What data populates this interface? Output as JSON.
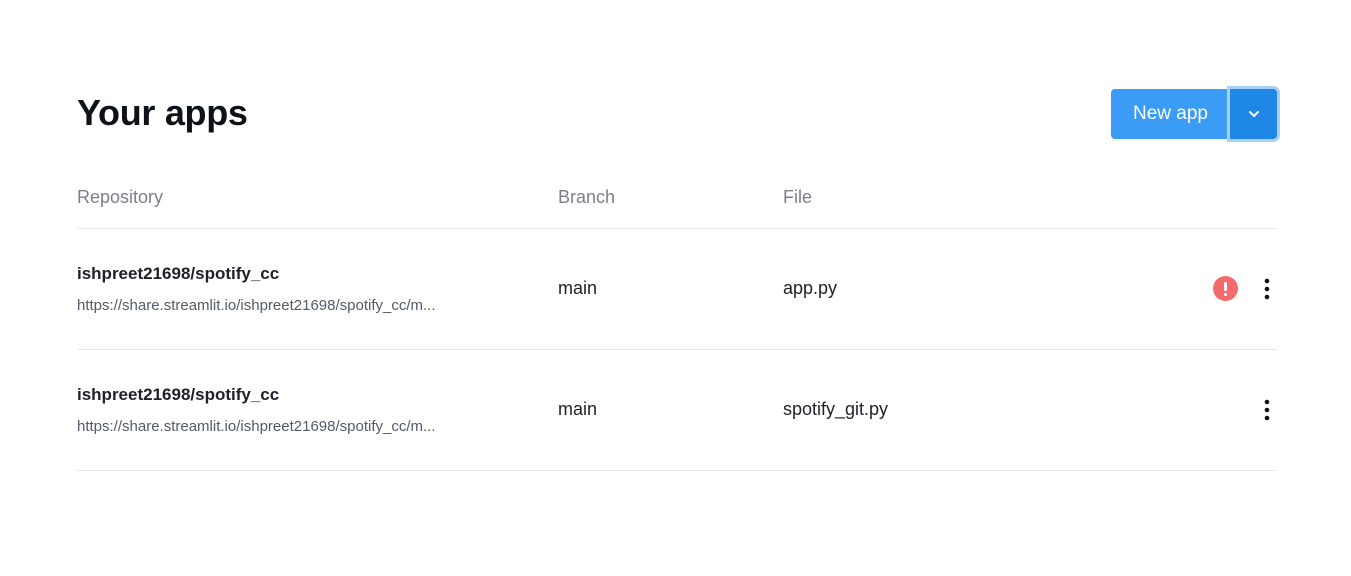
{
  "header": {
    "title": "Your apps",
    "new_app_label": "New app"
  },
  "table": {
    "columns": {
      "repository": "Repository",
      "branch": "Branch",
      "file": "File"
    },
    "rows": [
      {
        "repository": "ishpreet21698/spotify_cc",
        "url": "https://share.streamlit.io/ishpreet21698/spotify_cc/m...",
        "branch": "main",
        "file": "app.py",
        "status": "error"
      },
      {
        "repository": "ishpreet21698/spotify_cc",
        "url": "https://share.streamlit.io/ishpreet21698/spotify_cc/m...",
        "branch": "main",
        "file": "spotify_git.py",
        "status": "ok"
      }
    ]
  },
  "colors": {
    "primary": "#3b9cf5",
    "primary_dark": "#1f87e5",
    "error": "#f56b6b"
  },
  "icons": {
    "dropdown": "chevron-down-icon",
    "error": "exclamation-circle-icon",
    "more": "vertical-ellipsis-icon"
  }
}
